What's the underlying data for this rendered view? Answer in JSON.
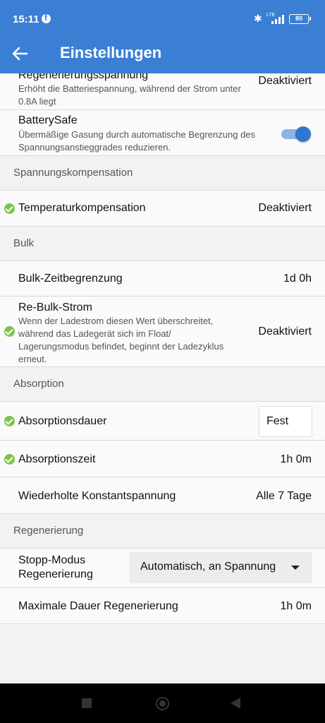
{
  "status_bar": {
    "time": "15:11",
    "network": "LTE",
    "battery": "80"
  },
  "header": {
    "title": "Einstellungen"
  },
  "regen_voltage": {
    "title": "Regenerierungsspannung",
    "description": "Erhöht die Batteriespannung, während der Strom unter 0.8A liegt",
    "value": "Deaktiviert"
  },
  "battery_safe": {
    "title": "BatterySafe",
    "description": "Übermäßige Gasung durch automatische Begrenzung des Spannungsanstieggrades reduzieren.",
    "enabled": true
  },
  "sections": {
    "voltage_comp": "Spannungskompensation",
    "bulk": "Bulk",
    "absorption": "Absorption",
    "regeneration": "Regenerierung"
  },
  "temp_comp": {
    "title": "Temperaturkompensation",
    "value": "Deaktiviert"
  },
  "bulk_time": {
    "title": "Bulk-Zeitbegrenzung",
    "value": "1d 0h"
  },
  "rebulk": {
    "title": "Re-Bulk-Strom",
    "description": "Wenn der Ladestrom diesen Wert überschreitet, während das Ladegerät sich im Float/ Lagerungsmodus befindet, beginnt der Ladezyklus erneut.",
    "value": "Deaktiviert"
  },
  "absorption_duration": {
    "title": "Absorptionsdauer",
    "value": "Fest"
  },
  "absorption_time": {
    "title": "Absorptionszeit",
    "value": "1h 0m"
  },
  "repeated_constant": {
    "title": "Wiederholte Konstantspannung",
    "value": "Alle 7 Tage"
  },
  "stop_mode": {
    "title_line1": "Stopp-Modus",
    "title_line2": "Regenerierung",
    "value": "Automatisch, an Spannung"
  },
  "max_regen": {
    "title": "Maximale Dauer Regenerierung",
    "value": "1h 0m"
  },
  "colors": {
    "accent": "#3a7fd4",
    "check": "#7cc34c",
    "toggle_on": "#2f78d0"
  }
}
